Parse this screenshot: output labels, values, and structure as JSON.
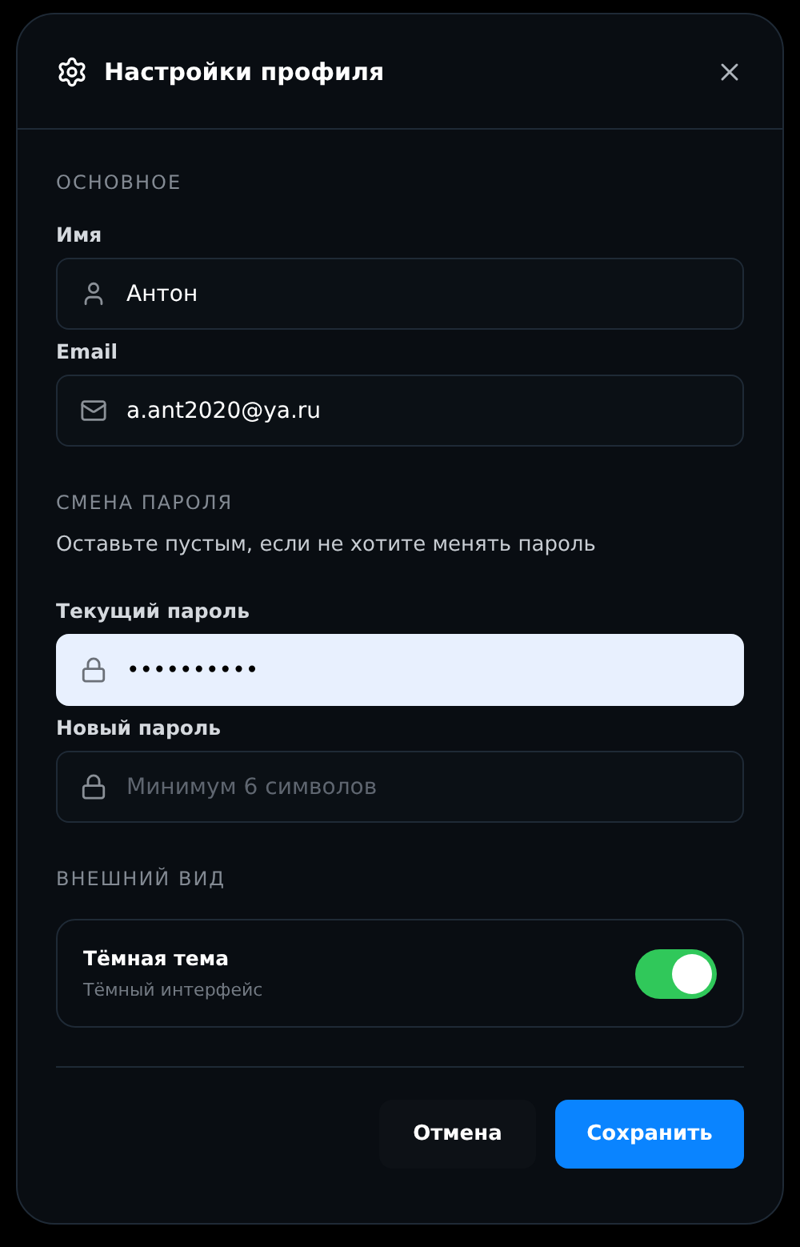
{
  "dialog": {
    "title": "Настройки профиля"
  },
  "sections": [
    {
      "title": "ОСНОВНОЕ",
      "fields": [
        {
          "label": "Имя",
          "kind": "user",
          "value": "Антон",
          "autofilled": false
        },
        {
          "label": "Email",
          "kind": "mail",
          "value": "a.ant2020@ya.ru",
          "autofilled": false
        }
      ]
    },
    {
      "title": "СМЕНА ПАРОЛЯ",
      "hint": "Оставьте пустым, если не хотите менять пароль",
      "fields": [
        {
          "label": "Текущий пароль",
          "kind": "lock",
          "value": "••••••••••",
          "autofilled": true
        },
        {
          "label": "Новый пароль",
          "kind": "lock",
          "placeholder": "Минимум 6 символов",
          "autofilled": false
        }
      ]
    },
    {
      "title": "ВНЕШНИЙ ВИД",
      "toggles": [
        {
          "label": "Тёмная тема",
          "description": "Тёмный интерфейс",
          "on": true
        }
      ]
    }
  ],
  "buttons": [
    {
      "label": "Отмена",
      "kind": "secondary"
    },
    {
      "label": "Сохранить",
      "kind": "primary"
    }
  ]
}
